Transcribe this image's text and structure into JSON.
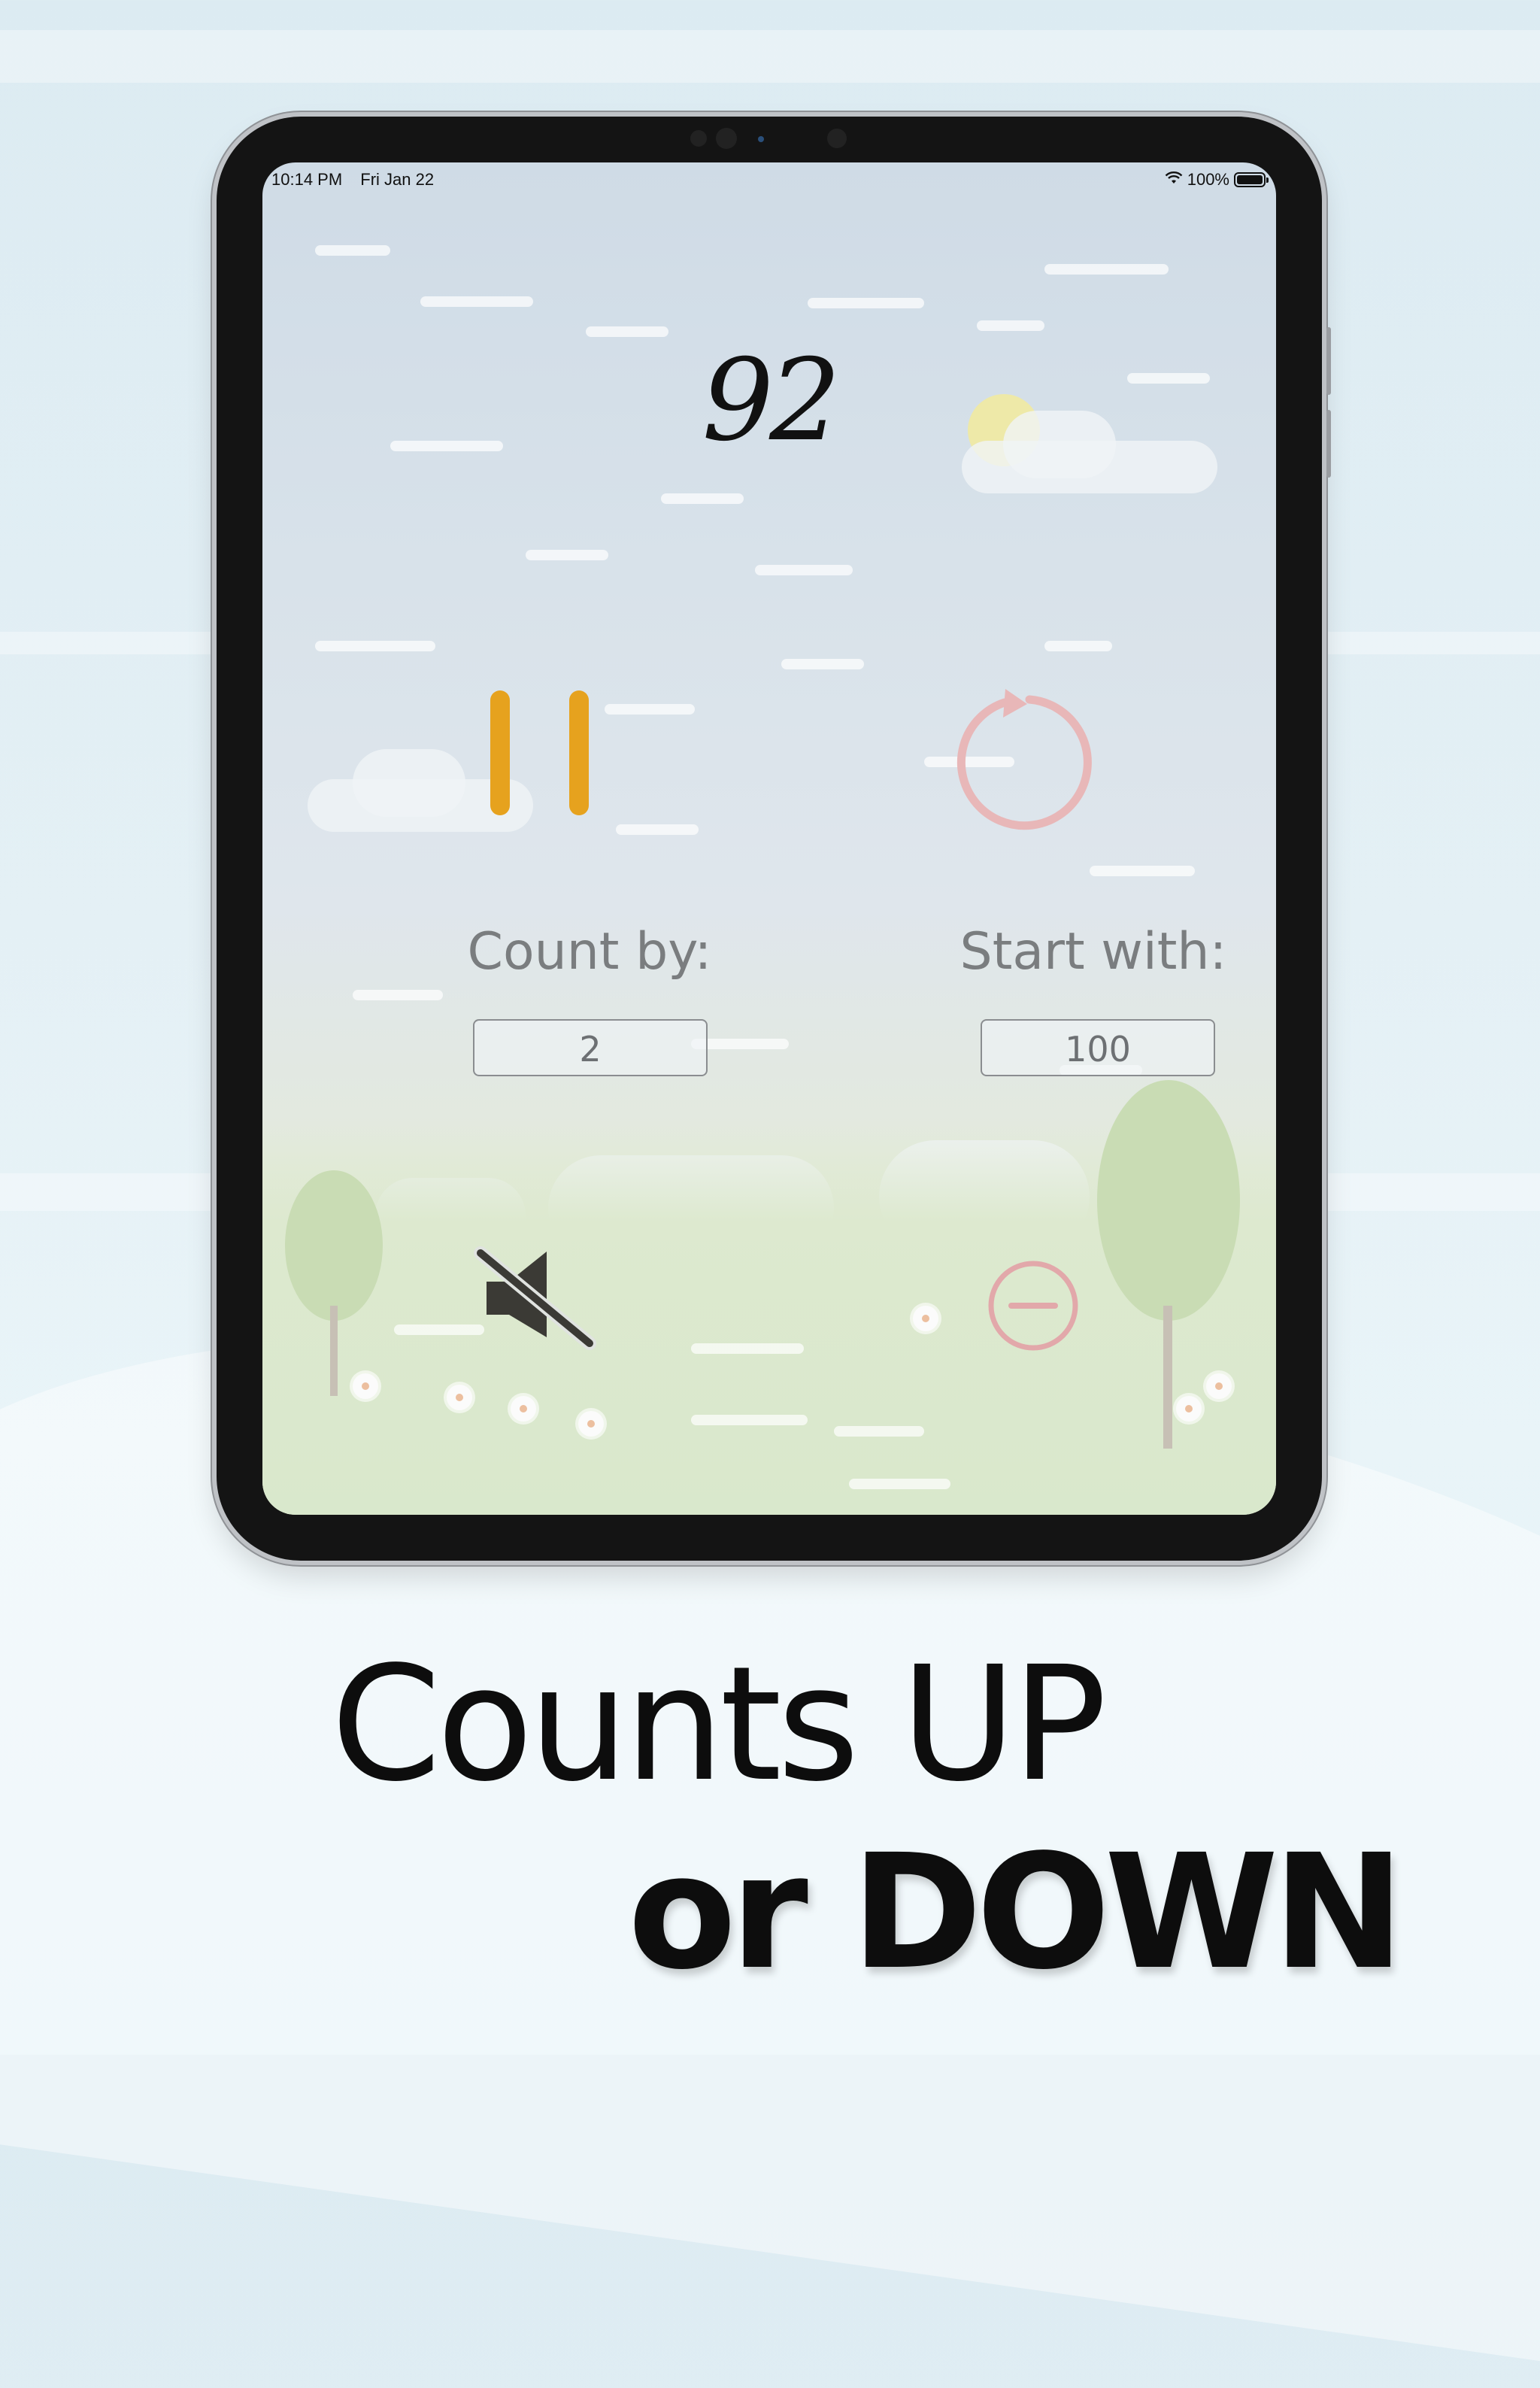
{
  "status_bar": {
    "time": "10:14 PM",
    "date": "Fri Jan 22",
    "battery": "100%"
  },
  "counter": {
    "value": "92",
    "value_color": "#111111"
  },
  "controls": {
    "pause_icon": "pause-icon",
    "pause_color": "#e6a21e",
    "reset_icon": "reset-icon",
    "reset_color": "#e8b7b8",
    "mute_icon": "speaker-muted-icon",
    "mute_color": "#3b3a35",
    "direction_icon": "minus-circle-icon",
    "direction_color": "#e2a8aa"
  },
  "settings": {
    "count_by_label": "Count by:",
    "count_by_value": "2",
    "start_with_label": "Start with:",
    "start_with_value": "100"
  },
  "marketing": {
    "line1": "Counts UP",
    "line2": "or DOWN"
  }
}
